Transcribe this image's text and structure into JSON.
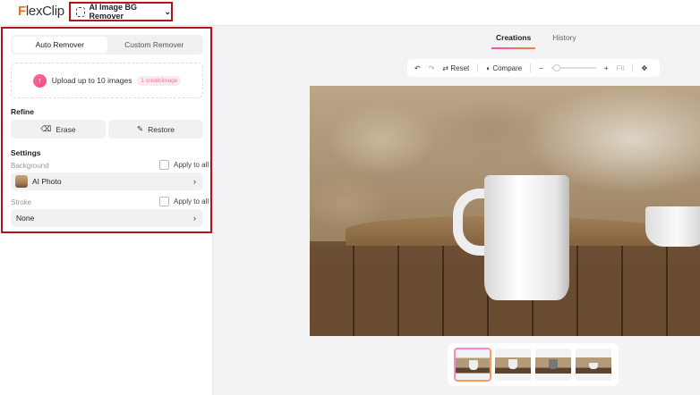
{
  "header": {
    "logo_prefix": "F",
    "logo_rest": "lexClip",
    "tool_label": "AI Image BG Remover",
    "tool_chevron": "⌄"
  },
  "annotation_color": "#b3141b",
  "left": {
    "modes": [
      {
        "label": "Auto Remover",
        "active": true
      },
      {
        "label": "Custom Remover",
        "active": false
      }
    ],
    "upload": {
      "label": "Upload up to 10 images",
      "badge": "1 credit/image",
      "icon": "upload-icon"
    },
    "refine": {
      "title": "Refine",
      "erase": "Erase",
      "restore": "Restore"
    },
    "settings": {
      "title": "Settings",
      "background_label": "Background",
      "background_apply": "Apply to all",
      "background_value": "AI Photo",
      "stroke_label": "Stroke",
      "stroke_apply": "Apply to all",
      "stroke_value": "None"
    }
  },
  "main": {
    "tabs": [
      {
        "label": "Creations",
        "active": true
      },
      {
        "label": "History",
        "active": false
      }
    ],
    "toolbar": {
      "undo": "↶",
      "redo": "↷",
      "reset": "Reset",
      "compare": "Compare",
      "zoom_out": "−",
      "zoom_in": "+",
      "fit": "Fit",
      "move": "✥",
      "zoom_level": 0.05
    },
    "thumbnails": [
      {
        "selected": true
      },
      {
        "selected": false
      },
      {
        "selected": false
      },
      {
        "selected": false
      }
    ]
  }
}
